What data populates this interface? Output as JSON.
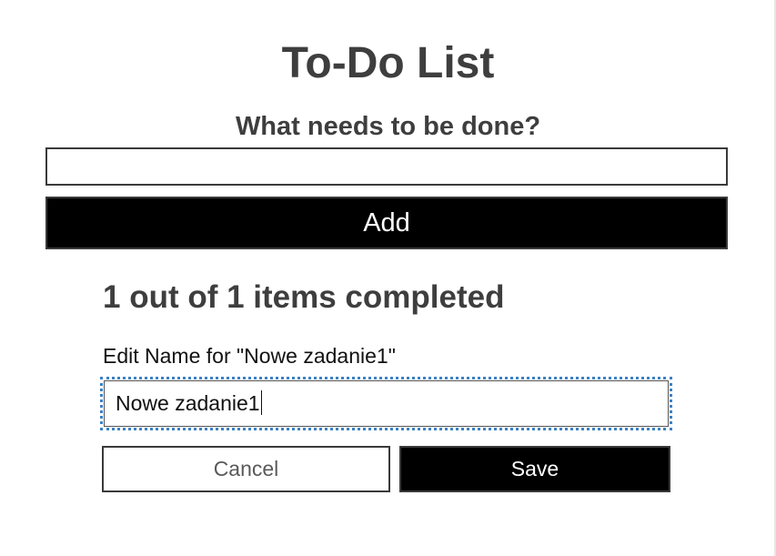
{
  "app": {
    "title": "To-Do List",
    "subtitle": "What needs to be done?"
  },
  "new_todo": {
    "value": "",
    "add_label": "Add"
  },
  "status": {
    "text": "1 out of 1 items completed"
  },
  "edit": {
    "label": "Edit Name for \"Nowe zadanie1\"",
    "value": "Nowe zadanie1",
    "cancel_label": "Cancel",
    "save_label": "Save"
  },
  "colors": {
    "heading_text": "#3e3e3e",
    "primary_button_bg": "#000000",
    "primary_button_text": "#ffffff",
    "focus_ring": "#3b82c4",
    "border": "#3a3a3a"
  }
}
